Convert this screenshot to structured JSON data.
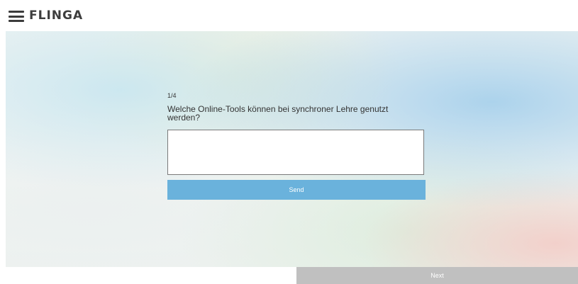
{
  "header": {
    "logo_text": "FLINGA",
    "menu_icon": "hamburger-menu-icon"
  },
  "question": {
    "counter": "1/4",
    "text": "Welche Online-Tools können bei synchroner Lehre genutzt werden?",
    "answer_value": "",
    "answer_placeholder": ""
  },
  "buttons": {
    "send_label": "Send",
    "next_label": "Next"
  },
  "colors": {
    "send_button": "#6ab2dc",
    "next_button": "#c0c0c0",
    "logo_text": "#3d3d3d"
  }
}
